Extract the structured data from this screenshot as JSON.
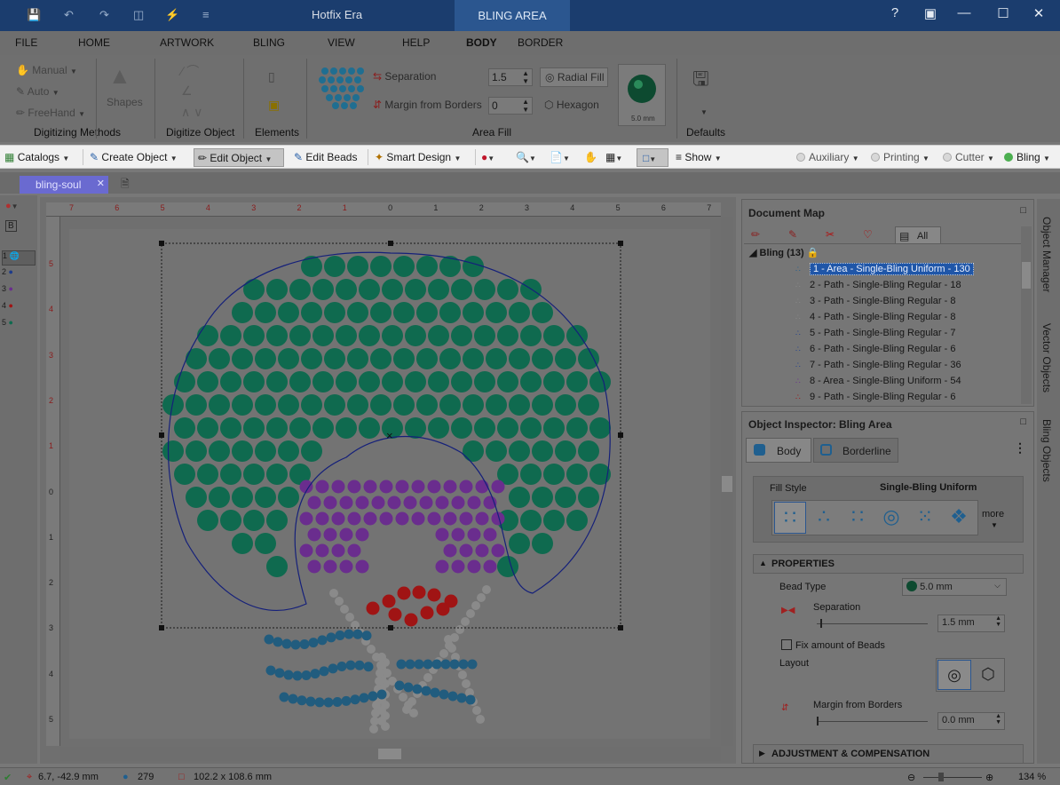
{
  "window": {
    "title": "Hotfix Era",
    "context_tab": "BLING AREA"
  },
  "ribbon_tabs": [
    "FILE",
    "HOME",
    "ARTWORK",
    "BLING",
    "VIEW",
    "HELP",
    "BODY",
    "BORDER"
  ],
  "ribbon": {
    "digitizing": {
      "manual": "Manual",
      "auto": "Auto",
      "freehand": "FreeHand",
      "label": "Digitizing Methods"
    },
    "shapes_label": "Shapes",
    "digitize_object_label": "Digitize Object",
    "elements_label": "Elements",
    "area_fill": {
      "separation_label": "Separation",
      "separation_value": "1.5",
      "margin_label": "Margin from Borders",
      "margin_value": "0",
      "radial_fill": "Radial Fill",
      "hexagon": "Hexagon",
      "bead_size": "5.0 mm",
      "label": "Area Fill"
    },
    "defaults_label": "Defaults"
  },
  "toolbar": {
    "catalogs": "Catalogs",
    "create_object": "Create Object",
    "edit_object": "Edit Object",
    "edit_beads": "Edit Beads",
    "smart_design": "Smart Design",
    "show": "Show",
    "auxiliary": "Auxiliary",
    "printing": "Printing",
    "cutter": "Cutter",
    "bling": "Bling"
  },
  "document_tab": "bling-soul",
  "layers": [
    "1",
    "2",
    "3",
    "4",
    "5"
  ],
  "ruler": {
    "unit": "cm",
    "h_ticks": [
      "7",
      "6",
      "5",
      "4",
      "3",
      "2",
      "1",
      "0",
      "1",
      "2",
      "3",
      "4",
      "5",
      "6",
      "7"
    ],
    "v_ticks": [
      "5",
      "4",
      "3",
      "2",
      "1",
      "0",
      "1",
      "2",
      "3",
      "4",
      "5"
    ]
  },
  "document_map": {
    "title": "Document Map",
    "tab_all": "All",
    "group": "Bling (13)",
    "items": [
      "1 - Area - Single-Bling Uniform - 130",
      "2 - Path - Single-Bling Regular - 18",
      "3 - Path - Single-Bling Regular - 8",
      "4 - Path - Single-Bling Regular - 8",
      "5 - Path - Single-Bling Regular - 7",
      "6 - Path - Single-Bling Regular - 6",
      "7 - Path - Single-Bling Regular - 36",
      "8 - Area - Single-Bling Uniform - 54",
      "9 - Path - Single-Bling Regular - 6"
    ]
  },
  "inspector": {
    "title": "Object Inspector: Bling Area",
    "tab_body": "Body",
    "tab_borderline": "Borderline",
    "fill_style_label": "Fill Style",
    "fill_style_value": "Single-Bling Uniform",
    "more": "more",
    "properties": "PROPERTIES",
    "bead_type_label": "Bead Type",
    "bead_type_value": "5.0 mm",
    "separation_label": "Separation",
    "separation_value": "1.5 mm",
    "fix_amount": "Fix amount of Beads",
    "layout_label": "Layout",
    "margin_label": "Margin from Borders",
    "margin_value": "0.0 mm",
    "adjustment": "ADJUSTMENT & COMPENSATION"
  },
  "side_tabs": [
    "Object Manager",
    "Vector Objects",
    "Bling Objects"
  ],
  "status": {
    "coords": "6.7, -42.9 mm",
    "count": "279",
    "size": "102.2 x 108.6 mm",
    "zoom": "134 %"
  },
  "colors": {
    "green_bead": "#0f6a4f",
    "purple_bead": "#6a2d8e",
    "red_bead": "#a01414",
    "blue_bead": "#215c7e",
    "gray_bead": "#8a8a8a",
    "accent": "#2b568f"
  }
}
